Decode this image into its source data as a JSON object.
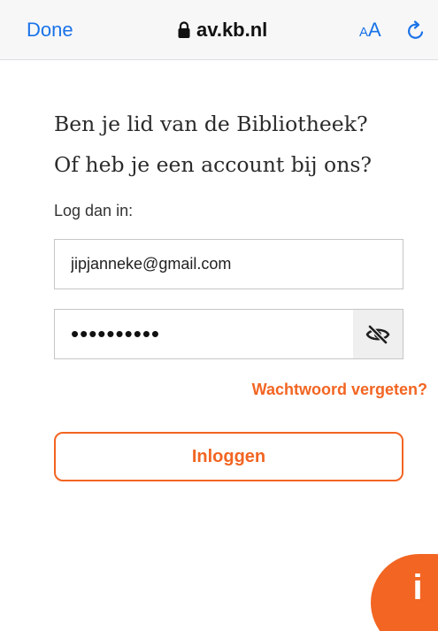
{
  "browser": {
    "done_label": "Done",
    "url": "av.kb.nl",
    "text_size_small": "A",
    "text_size_large": "A",
    "accent_color": "#1a73e8"
  },
  "login": {
    "heading_line1": "Ben je lid van de Bibliotheek?",
    "heading_line2": "Of heb je een account bij ons?",
    "subtitle": "Log dan in:",
    "email_value": "jipjanneke@gmail.com",
    "password_value": "••••••••••",
    "password_visibility_icon": "eye-off-icon",
    "forgot_password_label": "Wachtwoord vergeten?",
    "submit_label": "Inloggen",
    "brand_color": "#f26522"
  },
  "info_button": {
    "label": "i"
  }
}
